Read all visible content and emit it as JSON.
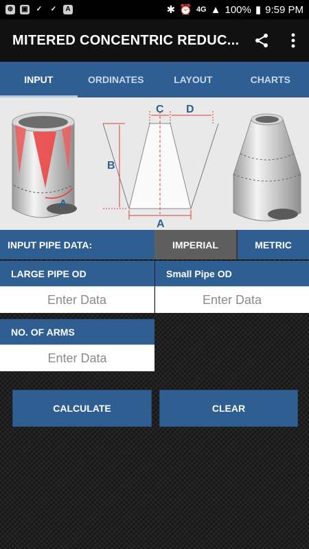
{
  "status_bar": {
    "battery": "100%",
    "time": "9:59 PM",
    "network": "4G"
  },
  "app_bar": {
    "title": "MITERED CONCENTRIC REDUC..."
  },
  "tabs": [
    {
      "label": "INPUT",
      "active": true
    },
    {
      "label": "ORDINATES",
      "active": false
    },
    {
      "label": "LAYOUT",
      "active": false
    },
    {
      "label": "CHARTS",
      "active": false
    }
  ],
  "diagram": {
    "labels": {
      "a": "A",
      "b": "B",
      "c": "C",
      "d": "D"
    }
  },
  "input_section": {
    "header": "INPUT PIPE DATA:",
    "units": {
      "imperial": "IMPERIAL",
      "metric": "METRIC",
      "selected": "IMPERIAL"
    }
  },
  "fields": {
    "large_pipe_od": {
      "label": "LARGE PIPE OD",
      "placeholder": "Enter Data",
      "value": ""
    },
    "small_pipe_od": {
      "label": "Small Pipe OD",
      "placeholder": "Enter Data",
      "value": ""
    },
    "no_of_arms": {
      "label": "NO. OF ARMS",
      "placeholder": "Enter Data",
      "value": ""
    }
  },
  "actions": {
    "calculate": "CALCULATE",
    "clear": "CLEAR"
  },
  "colors": {
    "primary": "#2f5f92",
    "selected_unit": "#5e5e5e",
    "accent_red": "#e53935"
  }
}
